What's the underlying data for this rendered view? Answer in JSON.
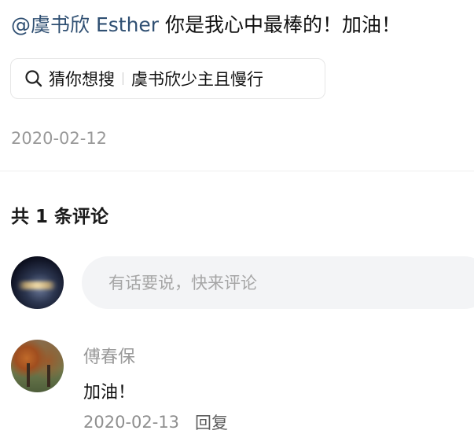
{
  "post": {
    "mention": "@虞书欣 Esther",
    "text": "你是我心中最棒的！加油！",
    "date": "2020-02-12"
  },
  "search_suggest": {
    "label": "猜你想搜",
    "query": "虞书欣少主且慢行"
  },
  "comments": {
    "count_label": "共 1 条评论",
    "input_placeholder": "有话要说，快来评论",
    "items": [
      {
        "author": "傅春保",
        "text": "加油！",
        "date": "2020-02-13",
        "reply_label": "回复"
      }
    ]
  },
  "icons": {
    "search": "search-icon"
  },
  "colors": {
    "mention": "#2f4f72",
    "muted": "#999999",
    "input_bg": "#f3f4f6"
  }
}
